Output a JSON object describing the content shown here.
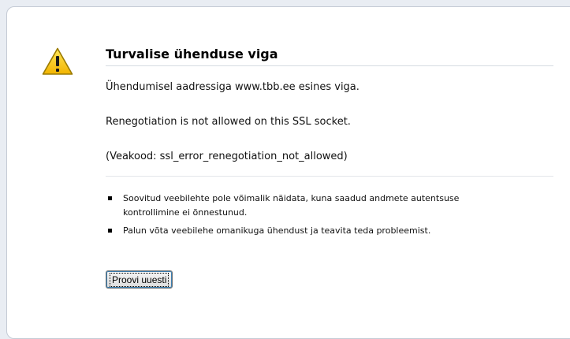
{
  "error": {
    "title": "Turvalise ühenduse viga",
    "message_address": "Ühendumisel aadressiga www.tbb.ee esines viga.",
    "message_detail": "Renegotiation is not allowed on this SSL socket.",
    "error_code": "(Veakood: ssl_error_renegotiation_not_allowed)",
    "bullets": [
      "Soovitud veebilehte pole võimalik näidata, kuna saadud andmete autentsuse kontrollimine ei õnnestunud.",
      "Palun võta veebilehe omanikuga ühendust ja teavita teda probleemist."
    ],
    "retry_label": "Proovi uuesti"
  },
  "icons": {
    "warning": "warning-icon"
  },
  "colors": {
    "page_background": "#e9edf3",
    "box_background": "#ffffff",
    "box_border": "#c4cbd5",
    "warning_fill": "#f5c400",
    "warning_outline": "#9a7a00"
  }
}
